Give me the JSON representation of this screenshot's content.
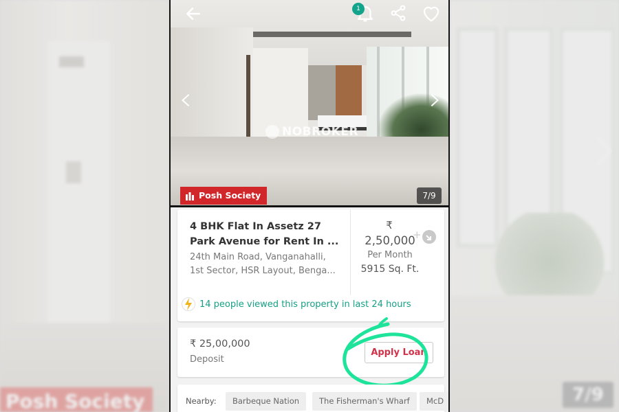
{
  "background": {
    "left_badge": "Posh Society",
    "right_counter": "7/9"
  },
  "header": {
    "notification_count": "1",
    "icons": [
      "back-arrow-icon",
      "bell-icon",
      "share-icon",
      "heart-icon"
    ]
  },
  "gallery": {
    "watermark": "NOBROKER",
    "badge": "Posh Society",
    "counter": "7/9"
  },
  "listing": {
    "title_line1": "4 BHK Flat In Assetz 27",
    "title_line2": "Park Avenue for Rent In ...",
    "address_line1": "24th Main Road, Vanganahalli,",
    "address_line2": "1st Sector, HSR Layout, Benga...",
    "currency": "₹",
    "rent": "2,50,000",
    "rent_period": "Per Month",
    "area": "5915 Sq. Ft.",
    "plus": "+",
    "views_text": "14 people viewed this property in last 24 hours"
  },
  "deposit": {
    "amount": "₹ 25,00,000",
    "label": "Deposit",
    "button_label": "Apply Loan"
  },
  "nearby": {
    "label": "Nearby:",
    "items": [
      "Barbeque Nation",
      "The Fisherman's Wharf",
      "McD"
    ]
  },
  "colors": {
    "accent_red": "#d1262a",
    "accent_green": "#16a085",
    "annotation_green": "#1ee39a",
    "badge_teal": "#14a38b"
  }
}
